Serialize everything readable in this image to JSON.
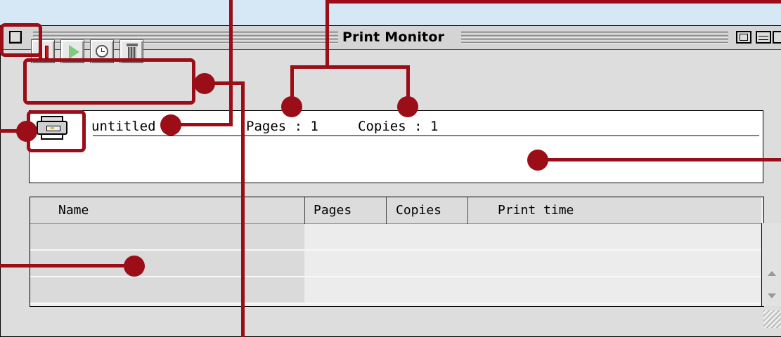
{
  "window": {
    "title": "Print Monitor"
  },
  "toolbar": {
    "buttons": [
      {
        "name": "pause",
        "icon": "pause-icon"
      },
      {
        "name": "resume",
        "icon": "play-icon"
      },
      {
        "name": "set-print-time",
        "icon": "clock-icon"
      },
      {
        "name": "remove-job",
        "icon": "trash-icon"
      }
    ]
  },
  "current_job": {
    "name": "untitled",
    "pages_label": "Pages : 1",
    "copies_label": "Copies : 1",
    "icon": "printer-icon"
  },
  "queue": {
    "columns": [
      "Name",
      "Pages",
      "Copies",
      "Print time"
    ],
    "rows": []
  },
  "colors": {
    "callout": "#9b0e17",
    "background": "#d6e8f6",
    "pause": "#e01010",
    "play": "#7ccc7c"
  }
}
